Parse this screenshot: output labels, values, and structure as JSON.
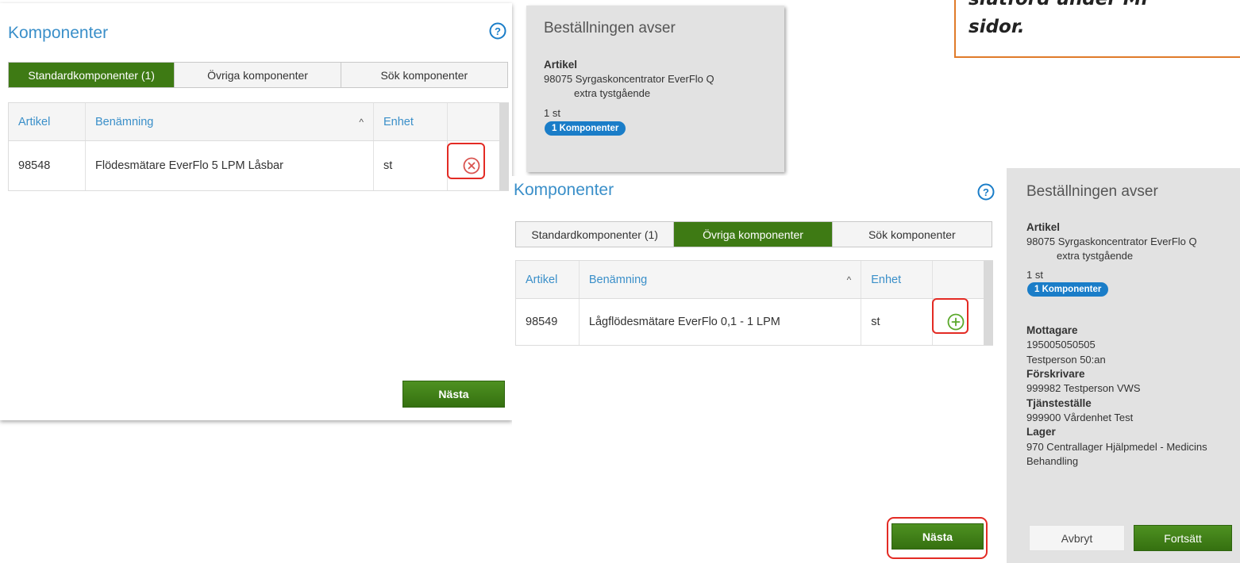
{
  "callout": {
    "text_line1": "slutförd under Mi",
    "text_line2": "sidor."
  },
  "panel_a": {
    "title": "Komponenter",
    "tabs": [
      {
        "label": "Standardkomponenter (1)",
        "active": true
      },
      {
        "label": "Övriga komponenter",
        "active": false
      },
      {
        "label": "Sök komponenter",
        "active": false
      }
    ],
    "table": {
      "headers": {
        "artikel": "Artikel",
        "benamning": "Benämning",
        "sort": "^",
        "enhet": "Enhet"
      },
      "rows": [
        {
          "artikel": "98548",
          "benamning": "Flödesmätare EverFlo 5 LPM Låsbar",
          "enhet": "st",
          "action": "remove-icon"
        }
      ]
    },
    "next_label": "Nästa"
  },
  "summary_a": {
    "title": "Beställningen avser",
    "artikel_label": "Artikel",
    "artikel_line1": "98075 Syrgaskoncentrator EverFlo Q",
    "artikel_line2": "extra tystgående",
    "quantity": "1 st",
    "badge": "1 Komponenter"
  },
  "panel_b": {
    "title": "Komponenter",
    "tabs": [
      {
        "label": "Standardkomponenter (1)",
        "active": false
      },
      {
        "label": "Övriga komponenter",
        "active": true
      },
      {
        "label": "Sök komponenter",
        "active": false
      }
    ],
    "table": {
      "headers": {
        "artikel": "Artikel",
        "benamning": "Benämning",
        "sort": "^",
        "enhet": "Enhet"
      },
      "rows": [
        {
          "artikel": "98549",
          "benamning": "Lågflödesmätare EverFlo 0,1 - 1 LPM",
          "enhet": "st",
          "action": "add-icon"
        }
      ]
    },
    "next_label": "Nästa"
  },
  "summary_b": {
    "title": "Beställningen avser",
    "artikel_label": "Artikel",
    "artikel_line1": "98075 Syrgaskoncentrator EverFlo Q",
    "artikel_line2": "extra tystgående",
    "quantity": "1 st",
    "badge": "1 Komponenter",
    "mottagare_label": "Mottagare",
    "mottagare_id": "195005050505",
    "mottagare_name": "Testperson 50:an",
    "forskrivare_label": "Förskrivare",
    "forskrivare_value": "999982 Testperson VWS",
    "tjanstestalle_label": "Tjänsteställe",
    "tjanstestalle_value": "999900 Vårdenhet Test",
    "lager_label": "Lager",
    "lager_line1": "970 Centrallager Hjälpmedel - Medicins",
    "lager_line2": "Behandling",
    "cancel_label": "Avbryt",
    "continue_label": "Fortsätt"
  },
  "colors": {
    "accent_green": "#3e7a14",
    "link_blue": "#3a8fc9",
    "badge_blue": "#1a7dc8",
    "highlight_red": "#e32b24",
    "callout_orange": "#e07b2a"
  }
}
